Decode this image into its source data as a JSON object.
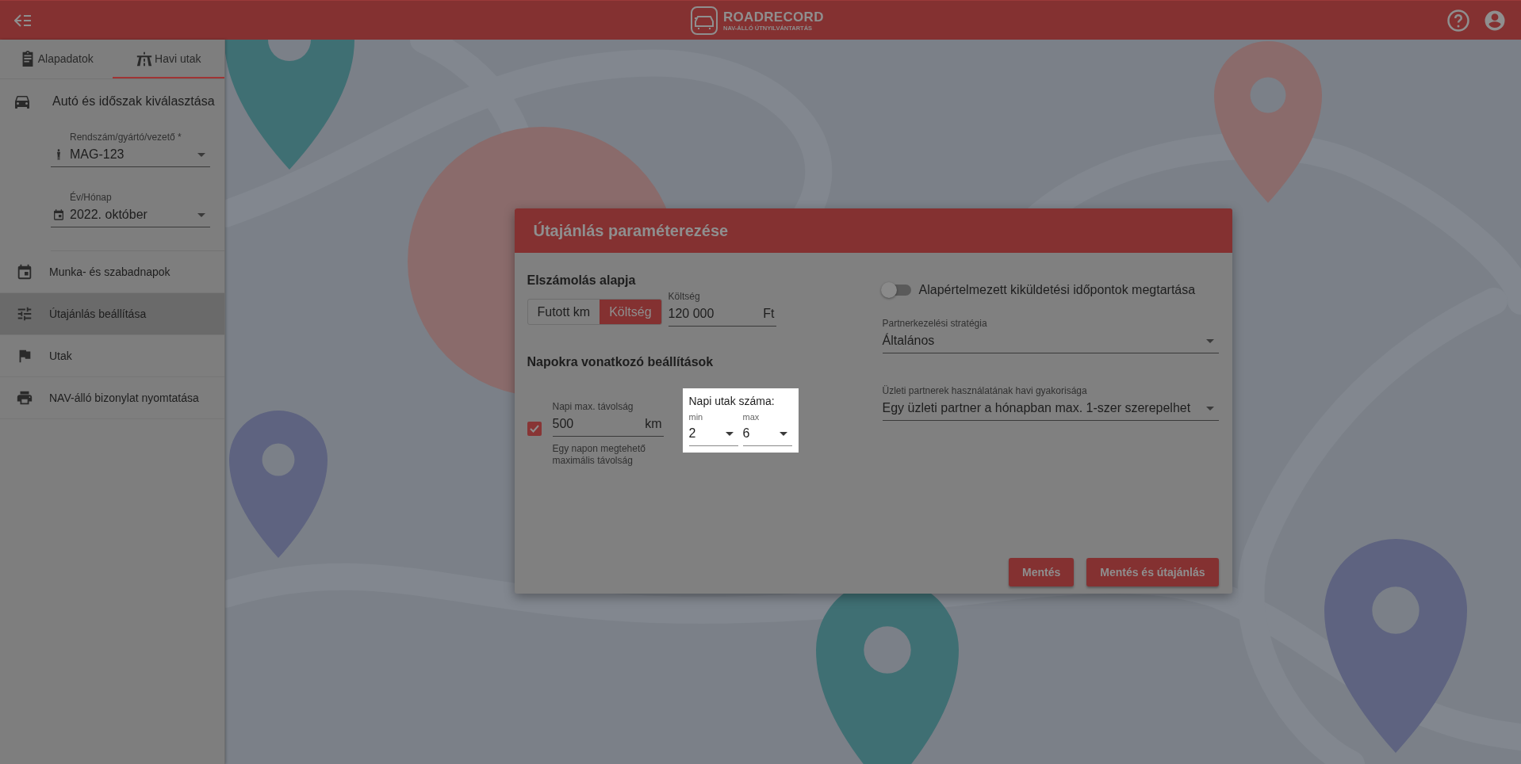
{
  "header": {
    "logo_title": "ROADRECORD",
    "logo_subtitle": "NAV-ÁLLÓ ÚTNYILVÁNTARTÁS"
  },
  "sidebar": {
    "tabs": [
      {
        "label": "Alapadatok",
        "kind": "clipboard",
        "selected": false
      },
      {
        "label": "Havi utak",
        "kind": "road",
        "selected": true
      }
    ],
    "section_title": "Autó és időszak kiválasztása",
    "fields": [
      {
        "label": "Rendszám/gyártó/vezető *",
        "value": "MAG-123",
        "kind": "person"
      },
      {
        "label": "Év/Hónap",
        "value": "2022. október",
        "kind": "date"
      }
    ],
    "items": [
      {
        "label": "Munka- és szabadnapok",
        "kind": "calendar",
        "selected": false
      },
      {
        "label": "Útajánlás beállítása",
        "kind": "tune",
        "selected": true
      },
      {
        "label": "Utak",
        "kind": "flag",
        "selected": false
      },
      {
        "label": "NAV-álló bizonylat nyomtatása",
        "kind": "print",
        "selected": false
      }
    ]
  },
  "dialog": {
    "title": "Útajánlás paraméterezése",
    "billing": {
      "heading": "Elszámolás alapja",
      "options": [
        {
          "label": "Futott km",
          "selected": false
        },
        {
          "label": "Költség",
          "selected": true
        }
      ],
      "cost_field": {
        "label": "Költség",
        "value": "120 000",
        "unit": "Ft"
      }
    },
    "daily": {
      "heading": "Napokra vonatkozó beállítások",
      "max_distance": {
        "checked": true,
        "label": "Napi max. távolság",
        "value": "500",
        "unit": "km",
        "hint": "Egy napon megtehető maximális távolság"
      },
      "trips": {
        "title": "Napi utak száma:",
        "min": {
          "label": "min",
          "value": "2"
        },
        "max": {
          "label": "max",
          "value": "6"
        }
      }
    },
    "keep_times": {
      "label": "Alapértelmezett kiküldetési időpontok megtartása",
      "on": false
    },
    "strategy": {
      "label": "Partnerkezelési stratégia",
      "value": "Általános"
    },
    "frequency": {
      "label": "Üzleti partnerek használatának havi gyakorisága",
      "value": "Egy üzleti partner a hónapban max. 1-szer szerepelhet"
    },
    "buttons": [
      {
        "label": "Mentés"
      },
      {
        "label": "Mentés és útajánlás"
      }
    ]
  }
}
